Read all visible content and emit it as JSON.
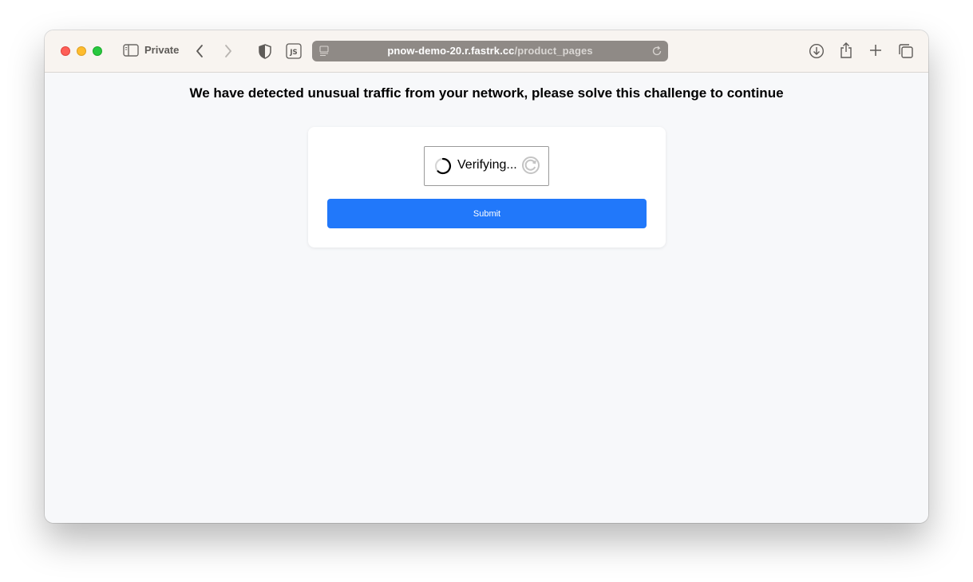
{
  "browser": {
    "mode_label": "Private",
    "url_host": "pnow-demo-20.r.fastrk.cc",
    "url_path": "/product_pages"
  },
  "page": {
    "headline": "We have detected unusual traffic from your network, please solve this challenge to continue",
    "captcha": {
      "status_text": "Verifying..."
    },
    "submit_label": "Submit"
  },
  "colors": {
    "accent": "#2178fa",
    "page_background": "#f7f8fa",
    "toolbar_background": "#f8f4f0"
  },
  "icons": {
    "sidebar": "sidebar-icon",
    "back": "chevron-left-icon",
    "forward": "chevron-right-icon",
    "shield": "shield-icon",
    "js": "js-icon",
    "page": "page-icon",
    "reload": "reload-icon",
    "download": "download-icon",
    "share": "share-icon",
    "new_tab": "plus-icon",
    "tabs": "tabs-overview-icon"
  }
}
